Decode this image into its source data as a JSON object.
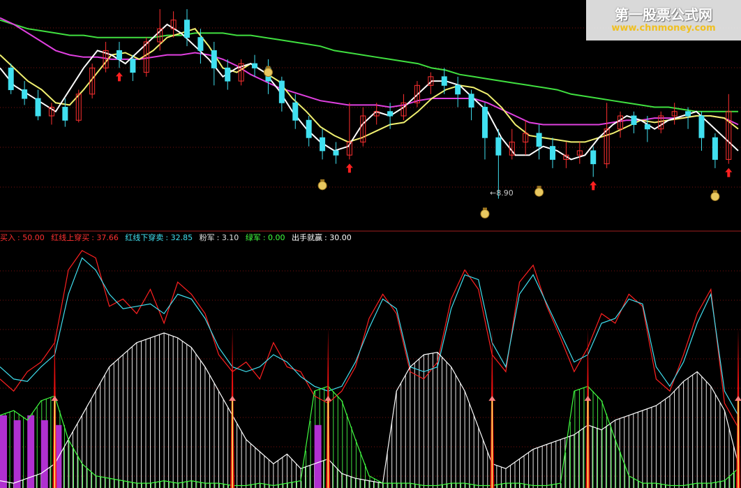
{
  "watermark": {
    "title": "第一股票公式网",
    "url": "www.chnmoney.com"
  },
  "main_chart": {
    "low_price_label": "8.90"
  },
  "indicator_legend": [
    {
      "name": "买入",
      "value": "50.00",
      "color": "#ff3030"
    },
    {
      "name": "红线上穿买",
      "value": "37.66",
      "color": "#ff3030"
    },
    {
      "name": "红线下穿卖",
      "value": "32.85",
      "color": "#40e0f0"
    },
    {
      "name": "粉军",
      "value": "3.10",
      "color": "#e0e0e0"
    },
    {
      "name": "绿军",
      "value": "0.00",
      "color": "#40ff40"
    },
    {
      "name": "出手就赢",
      "value": "30.00",
      "color": "#ffffff"
    }
  ],
  "chart_data": [
    {
      "type": "candlestick",
      "title": "",
      "candles_note": "price candles with moving averages",
      "ma_series": [
        {
          "color": "#40e040",
          "values": [
            0.94,
            0.92,
            0.9,
            0.89,
            0.88,
            0.87,
            0.87,
            0.86,
            0.86,
            0.86,
            0.86,
            0.86,
            0.87,
            0.87,
            0.88,
            0.88,
            0.88,
            0.87,
            0.87,
            0.86,
            0.85,
            0.84,
            0.83,
            0.82,
            0.8,
            0.79,
            0.78,
            0.77,
            0.76,
            0.75,
            0.74,
            0.72,
            0.71,
            0.69,
            0.68,
            0.67,
            0.66,
            0.65,
            0.64,
            0.63,
            0.62,
            0.6,
            0.59,
            0.58,
            0.57,
            0.56,
            0.55,
            0.54,
            0.54,
            0.53,
            0.52,
            0.52,
            0.52,
            0.52
          ]
        },
        {
          "color": "#e040e0",
          "values": [
            0.95,
            0.92,
            0.88,
            0.84,
            0.8,
            0.78,
            0.77,
            0.77,
            0.76,
            0.76,
            0.76,
            0.77,
            0.78,
            0.78,
            0.79,
            0.78,
            0.76,
            0.73,
            0.69,
            0.66,
            0.63,
            0.61,
            0.59,
            0.57,
            0.56,
            0.55,
            0.55,
            0.55,
            0.54,
            0.55,
            0.57,
            0.58,
            0.58,
            0.58,
            0.58,
            0.56,
            0.53,
            0.5,
            0.47,
            0.46,
            0.46,
            0.46,
            0.46,
            0.46,
            0.47,
            0.48,
            0.48,
            0.49,
            0.49,
            0.49,
            0.5,
            0.5,
            0.49,
            0.46
          ]
        },
        {
          "color": "#f0f070",
          "values": [
            0.78,
            0.72,
            0.66,
            0.62,
            0.56,
            0.55,
            0.62,
            0.7,
            0.78,
            0.79,
            0.76,
            0.8,
            0.86,
            0.88,
            0.9,
            0.82,
            0.72,
            0.7,
            0.74,
            0.7,
            0.66,
            0.58,
            0.52,
            0.45,
            0.41,
            0.38,
            0.4,
            0.43,
            0.46,
            0.47,
            0.52,
            0.58,
            0.62,
            0.64,
            0.63,
            0.6,
            0.54,
            0.46,
            0.41,
            0.4,
            0.39,
            0.38,
            0.38,
            0.4,
            0.42,
            0.45,
            0.48,
            0.47,
            0.48,
            0.49,
            0.5,
            0.5,
            0.49,
            0.44
          ]
        },
        {
          "color": "#ffffff",
          "values": [
            0.72,
            0.64,
            0.6,
            0.56,
            0.52,
            0.62,
            0.72,
            0.8,
            0.78,
            0.74,
            0.8,
            0.86,
            0.92,
            0.88,
            0.82,
            0.76,
            0.68,
            0.72,
            0.74,
            0.7,
            0.62,
            0.52,
            0.44,
            0.38,
            0.34,
            0.36,
            0.46,
            0.52,
            0.5,
            0.54,
            0.6,
            0.66,
            0.66,
            0.64,
            0.58,
            0.52,
            0.4,
            0.32,
            0.32,
            0.36,
            0.34,
            0.3,
            0.32,
            0.4,
            0.46,
            0.5,
            0.48,
            0.44,
            0.48,
            0.5,
            0.52,
            0.46,
            0.4,
            0.34
          ]
        }
      ],
      "candles": [
        [
          0.72,
          0.62,
          0.74,
          0.6
        ],
        [
          0.62,
          0.58,
          0.66,
          0.55
        ],
        [
          0.58,
          0.5,
          0.62,
          0.48
        ],
        [
          0.5,
          0.54,
          0.56,
          0.46
        ],
        [
          0.54,
          0.48,
          0.58,
          0.45
        ],
        [
          0.48,
          0.6,
          0.62,
          0.47
        ],
        [
          0.6,
          0.72,
          0.74,
          0.58
        ],
        [
          0.72,
          0.8,
          0.84,
          0.7
        ],
        [
          0.8,
          0.76,
          0.84,
          0.72
        ],
        [
          0.76,
          0.7,
          0.78,
          0.66
        ],
        [
          0.7,
          0.84,
          0.86,
          0.68
        ],
        [
          0.84,
          0.9,
          0.99,
          0.8
        ],
        [
          0.9,
          0.94,
          0.98,
          0.86
        ],
        [
          0.94,
          0.86,
          0.99,
          0.82
        ],
        [
          0.86,
          0.8,
          0.9,
          0.74
        ],
        [
          0.8,
          0.72,
          0.84,
          0.64
        ],
        [
          0.72,
          0.66,
          0.76,
          0.62
        ],
        [
          0.66,
          0.74,
          0.76,
          0.64
        ],
        [
          0.74,
          0.72,
          0.78,
          0.68
        ],
        [
          0.72,
          0.66,
          0.76,
          0.6
        ],
        [
          0.66,
          0.56,
          0.68,
          0.52
        ],
        [
          0.56,
          0.48,
          0.6,
          0.44
        ],
        [
          0.48,
          0.4,
          0.5,
          0.36
        ],
        [
          0.4,
          0.34,
          0.44,
          0.3
        ],
        [
          0.34,
          0.32,
          0.38,
          0.28
        ],
        [
          0.32,
          0.38,
          0.56,
          0.3
        ],
        [
          0.38,
          0.5,
          0.54,
          0.36
        ],
        [
          0.5,
          0.52,
          0.56,
          0.46
        ],
        [
          0.52,
          0.5,
          0.56,
          0.44
        ],
        [
          0.5,
          0.56,
          0.6,
          0.48
        ],
        [
          0.56,
          0.64,
          0.66,
          0.54
        ],
        [
          0.64,
          0.68,
          0.7,
          0.6
        ],
        [
          0.68,
          0.64,
          0.72,
          0.6
        ],
        [
          0.64,
          0.6,
          0.68,
          0.54
        ],
        [
          0.6,
          0.54,
          0.62,
          0.48
        ],
        [
          0.54,
          0.4,
          0.56,
          0.3
        ],
        [
          0.4,
          0.32,
          0.44,
          0.12
        ],
        [
          0.32,
          0.38,
          0.44,
          0.3
        ],
        [
          0.38,
          0.42,
          0.48,
          0.32
        ],
        [
          0.42,
          0.36,
          0.46,
          0.3
        ],
        [
          0.36,
          0.3,
          0.4,
          0.26
        ],
        [
          0.3,
          0.32,
          0.38,
          0.26
        ],
        [
          0.32,
          0.34,
          0.38,
          0.28
        ],
        [
          0.34,
          0.28,
          0.36,
          0.22
        ],
        [
          0.28,
          0.44,
          0.56,
          0.26
        ],
        [
          0.44,
          0.5,
          0.52,
          0.4
        ],
        [
          0.5,
          0.46,
          0.52,
          0.42
        ],
        [
          0.46,
          0.44,
          0.5,
          0.38
        ],
        [
          0.44,
          0.5,
          0.52,
          0.42
        ],
        [
          0.5,
          0.52,
          0.56,
          0.46
        ],
        [
          0.52,
          0.5,
          0.54,
          0.44
        ],
        [
          0.5,
          0.4,
          0.52,
          0.34
        ],
        [
          0.4,
          0.3,
          0.42,
          0.26
        ],
        [
          0.3,
          0.52,
          0.6,
          0.28
        ]
      ],
      "markers": {
        "buy_arrows": [
          8,
          25,
          43,
          53
        ],
        "money_bags": [
          {
            "i": 19,
            "level": 0.7
          },
          {
            "i": 23,
            "level": 0.18
          },
          {
            "i": 35,
            "level": 0.05
          },
          {
            "i": 39,
            "level": 0.15
          },
          {
            "i": 52,
            "level": 0.13
          }
        ]
      }
    },
    {
      "type": "line",
      "title": "",
      "ylim": [
        0,
        100
      ],
      "series": [
        {
          "name": "红线上穿买",
          "color": "#ff2020",
          "values": [
            45,
            40,
            48,
            52,
            60,
            90,
            98,
            95,
            75,
            78,
            72,
            82,
            68,
            85,
            80,
            72,
            55,
            48,
            52,
            45,
            60,
            50,
            48,
            38,
            35,
            40,
            50,
            70,
            80,
            72,
            48,
            45,
            52,
            78,
            90,
            82,
            55,
            48,
            85,
            92,
            75,
            62,
            48,
            58,
            72,
            68,
            80,
            75,
            45,
            40,
            55,
            72,
            82,
            35,
            25
          ]
        },
        {
          "name": "红线下穿卖",
          "color": "#40e0f0",
          "values": [
            50,
            45,
            44,
            50,
            55,
            80,
            95,
            90,
            80,
            74,
            75,
            76,
            72,
            80,
            78,
            70,
            58,
            50,
            48,
            50,
            55,
            52,
            46,
            42,
            40,
            42,
            52,
            66,
            78,
            74,
            50,
            48,
            50,
            74,
            88,
            86,
            60,
            50,
            80,
            88,
            76,
            64,
            52,
            55,
            68,
            70,
            78,
            76,
            50,
            42,
            52,
            68,
            80,
            40,
            30
          ]
        },
        {
          "name": "粉军",
          "color": "#ffffff",
          "values": [
            3,
            2,
            4,
            6,
            10,
            20,
            30,
            40,
            50,
            55,
            60,
            62,
            64,
            62,
            58,
            50,
            40,
            30,
            20,
            15,
            10,
            14,
            8,
            10,
            12,
            6,
            4,
            3,
            2,
            40,
            50,
            55,
            56,
            50,
            40,
            25,
            10,
            8,
            12,
            16,
            18,
            20,
            22,
            26,
            24,
            28,
            30,
            32,
            34,
            38,
            44,
            48,
            42,
            32,
            10
          ]
        },
        {
          "name": "绿军",
          "color": "#40ff40",
          "values": [
            30,
            32,
            28,
            36,
            38,
            20,
            10,
            5,
            4,
            3,
            2,
            2,
            3,
            2,
            3,
            2,
            2,
            1,
            1,
            2,
            1,
            2,
            3,
            40,
            42,
            36,
            20,
            5,
            2,
            2,
            2,
            1,
            1,
            2,
            2,
            1,
            1,
            2,
            2,
            1,
            1,
            2,
            40,
            42,
            36,
            20,
            5,
            2,
            2,
            1,
            1,
            2,
            2,
            3,
            8
          ]
        },
        {
          "name": "出手就赢",
          "color": "#ffff60",
          "values": [
            0,
            0,
            0,
            0,
            0,
            0,
            0,
            0,
            0,
            0,
            0,
            30,
            0,
            0,
            0,
            0,
            0,
            0,
            0,
            0,
            0,
            0,
            0,
            0,
            0,
            0,
            0,
            0,
            0,
            0,
            30,
            0,
            0,
            0,
            0,
            0,
            0,
            0,
            0,
            0,
            0,
            30,
            0,
            0,
            0,
            0,
            0,
            0,
            0,
            0,
            0,
            0,
            0,
            30,
            30
          ]
        }
      ],
      "spikes": [
        4,
        17,
        24,
        36,
        43,
        54
      ],
      "purple_bars": [
        [
          0,
          1,
          2,
          3,
          4,
          23
        ],
        [
          18,
          16,
          18,
          16,
          14,
          14
        ]
      ]
    }
  ]
}
